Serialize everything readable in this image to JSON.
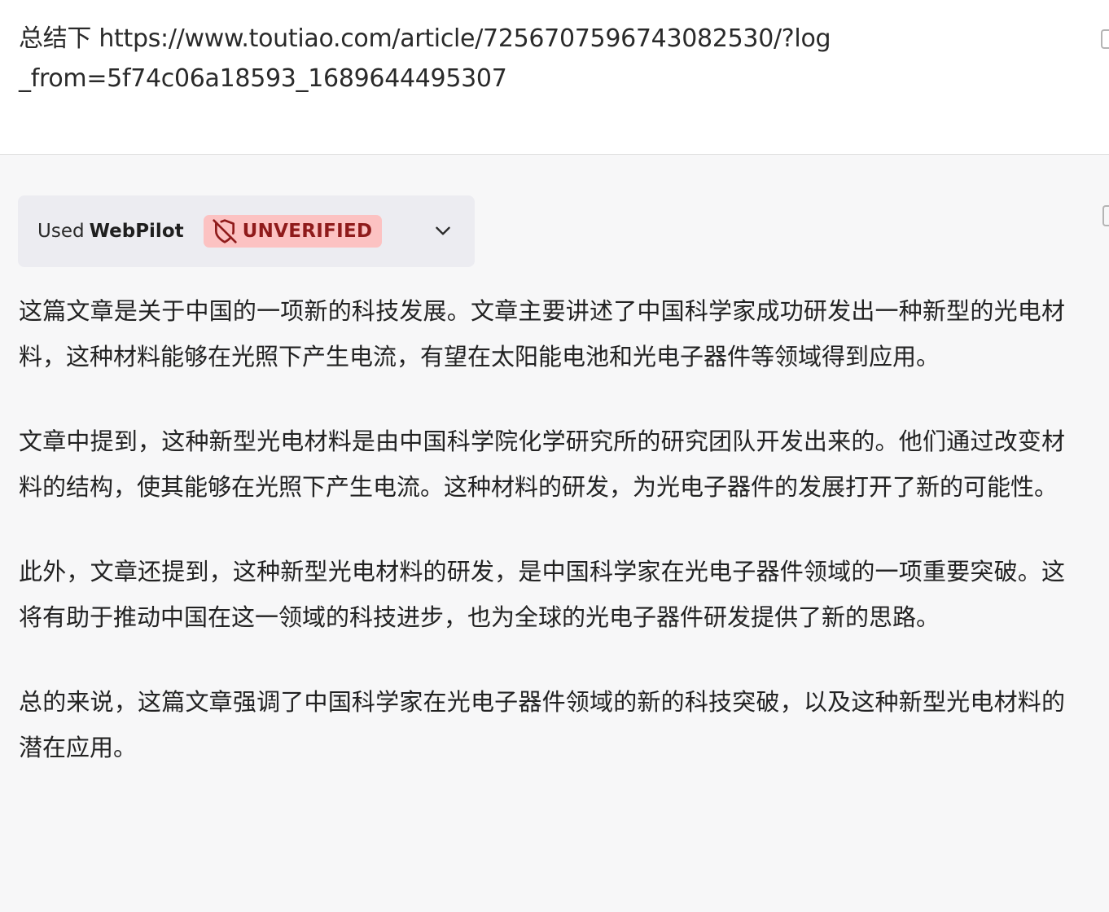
{
  "user_message": {
    "text": "总结下 https://www.toutiao.com/article/7256707596743082530/?log_from=5f74c06a18593_1689644495307"
  },
  "plugin": {
    "used_label": "Used",
    "name": "WebPilot",
    "badge_label": "UNVERIFIED",
    "badge_icon": "shield-off-icon",
    "badge_color": "#fcc2c2",
    "badge_text_color": "#8f1b1b"
  },
  "response": {
    "paragraphs": [
      "这篇文章是关于中国的一项新的科技发展。文章主要讲述了中国科学家成功研发出一种新型的光电材料，这种材料能够在光照下产生电流，有望在太阳能电池和光电子器件等领域得到应用。",
      "文章中提到，这种新型光电材料是由中国科学院化学研究所的研究团队开发出来的。他们通过改变材料的结构，使其能够在光照下产生电流。这种材料的研发，为光电子器件的发展打开了新的可能性。",
      "此外，文章还提到，这种新型光电材料的研发，是中国科学家在光电子器件领域的一项重要突破。这将有助于推动中国在这一领域的科技进步，也为全球的光电子器件研发提供了新的思路。",
      "总的来说，这篇文章强调了中国科学家在光电子器件领域的新的科技突破，以及这种新型光电材料的潜在应用。"
    ]
  }
}
